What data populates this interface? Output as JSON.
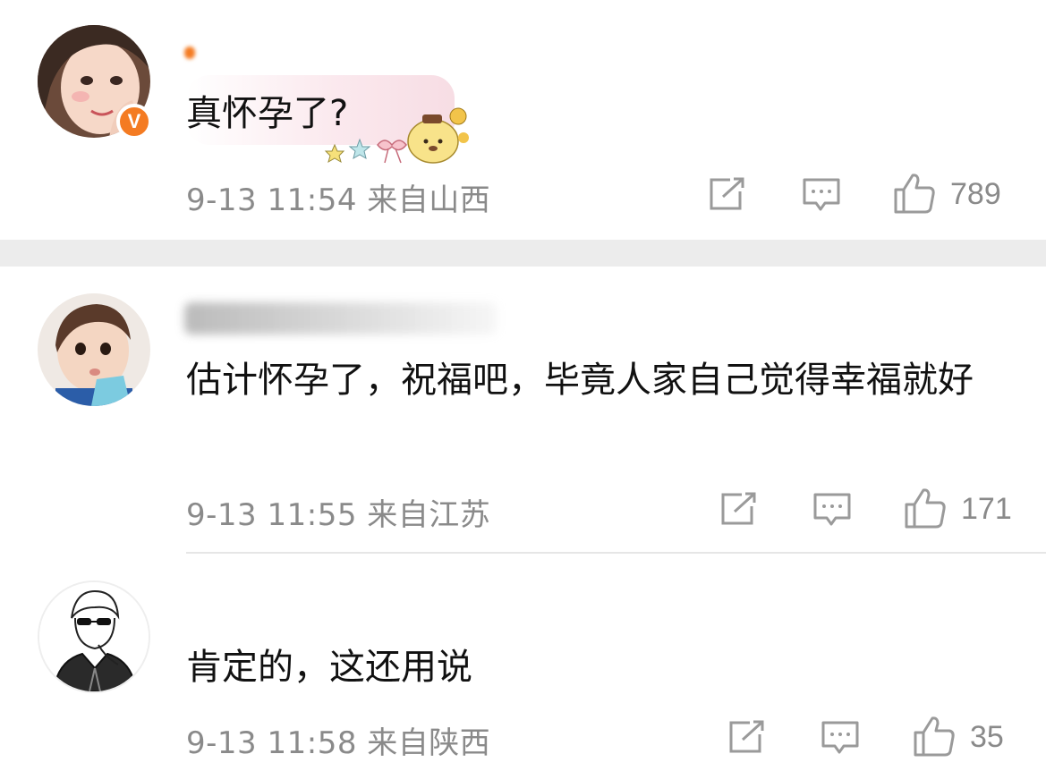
{
  "comments": [
    {
      "text": "真怀孕了?",
      "meta": "9-13 11:54 来自山西",
      "likes": "789",
      "verified_badge": "V",
      "avatar_icon": "girl-portrait"
    },
    {
      "text": "估计怀孕了，祝福吧，毕竟人家自己觉得幸福就好",
      "meta": "9-13 11:55 来自江苏",
      "likes": "171",
      "avatar_icon": "toddler-portrait"
    },
    {
      "text": "肯定的，这还用说",
      "meta": "9-13 11:58 来自陕西",
      "likes": "35",
      "avatar_icon": "sketch-man-portrait"
    }
  ],
  "icons": {
    "repost": "repost-icon",
    "comment": "comment-icon",
    "like": "thumbs-up-icon"
  },
  "colors": {
    "meta_gray": "#8a8a8a",
    "verified_orange": "#f47b22",
    "separator": "#ececec"
  }
}
